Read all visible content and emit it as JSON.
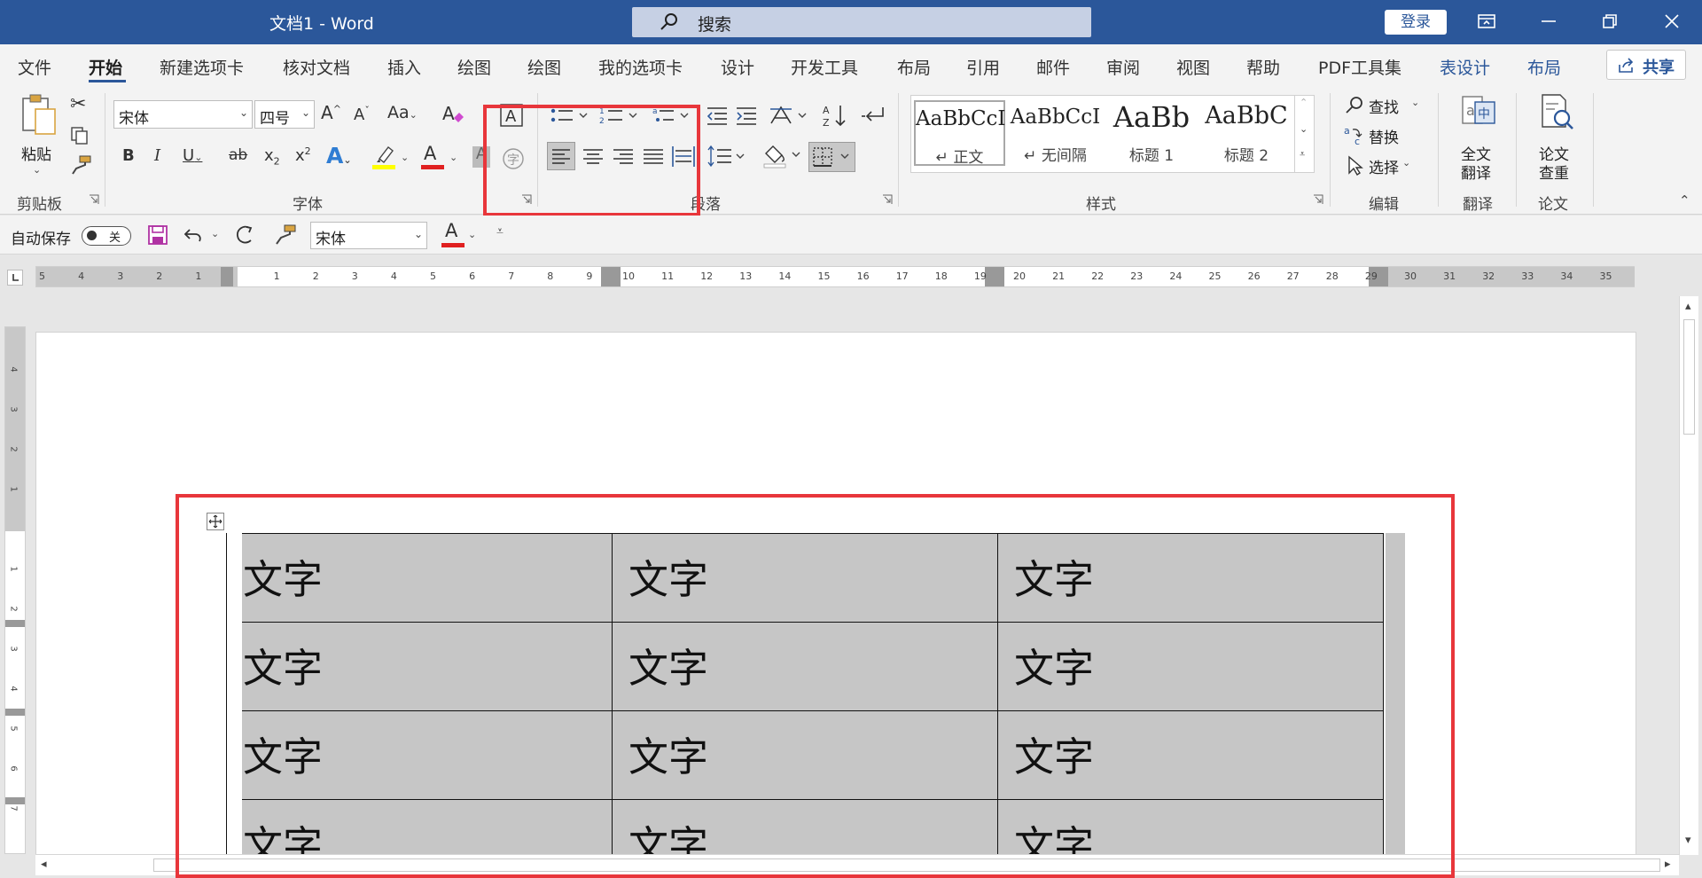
{
  "title_bar": {
    "doc_title": "文档1  -  Word",
    "search_placeholder": "搜索",
    "login_label": "登录"
  },
  "ribbon_tabs": [
    {
      "label": "文件"
    },
    {
      "label": "开始",
      "active": true
    },
    {
      "label": "新建选项卡"
    },
    {
      "label": "核对文档"
    },
    {
      "label": "插入"
    },
    {
      "label": "绘图"
    },
    {
      "label": "绘图"
    },
    {
      "label": "我的选项卡"
    },
    {
      "label": "设计"
    },
    {
      "label": "开发工具"
    },
    {
      "label": "布局"
    },
    {
      "label": "引用"
    },
    {
      "label": "邮件"
    },
    {
      "label": "审阅"
    },
    {
      "label": "视图"
    },
    {
      "label": "帮助"
    },
    {
      "label": "PDF工具集"
    },
    {
      "label": "表设计",
      "contextual": true
    },
    {
      "label": "布局",
      "contextual": true
    }
  ],
  "share_label": "共享",
  "clipboard": {
    "paste_label": "粘贴",
    "group_label": "剪贴板"
  },
  "font": {
    "name": "宋体",
    "size": "四号",
    "group_label": "字体"
  },
  "paragraph": {
    "group_label": "段落"
  },
  "styles": {
    "group_label": "样式",
    "cards": [
      {
        "sample": "AaBbCcI",
        "name": "↵ 正文"
      },
      {
        "sample": "AaBbCcI",
        "name": "↵ 无间隔"
      },
      {
        "sample": "AaBb",
        "name": "标题 1"
      },
      {
        "sample": "AaBbC",
        "name": "标题 2"
      }
    ]
  },
  "editing": {
    "find_label": "查找",
    "replace_label": "替换",
    "select_label": "选择",
    "group_label": "编辑"
  },
  "translate": {
    "button_label_1": "全文",
    "button_label_2": "翻译",
    "group_label": "翻译"
  },
  "thesis": {
    "button_label_1": "论文",
    "button_label_2": "查重",
    "group_label": "论文"
  },
  "qat": {
    "autosave_label": "自动保存",
    "autosave_state": "关",
    "font_name": "宋体"
  },
  "ruler": {
    "ticks": [
      "5",
      "4",
      "3",
      "2",
      "1",
      "1",
      "2",
      "3",
      "4",
      "5",
      "6",
      "7",
      "8",
      "9",
      "10",
      "11",
      "12",
      "13",
      "14",
      "15",
      "16",
      "17",
      "18",
      "19",
      "20",
      "21",
      "22",
      "23",
      "24",
      "25",
      "26",
      "27",
      "28",
      "29",
      "30",
      "31",
      "32",
      "33",
      "34",
      "35"
    ],
    "vticks": [
      "4",
      "3",
      "2",
      "1",
      "1",
      "2",
      "3",
      "4",
      "5",
      "6",
      "7"
    ]
  },
  "table": {
    "rows": [
      [
        "文字",
        "文字",
        "文字"
      ],
      [
        "文字",
        "文字",
        "文字"
      ],
      [
        "文字",
        "文字",
        "文字"
      ],
      [
        "文字",
        "文字",
        "文字"
      ]
    ]
  },
  "colors": {
    "accent": "#2b579a",
    "highlight_box": "#e8363b",
    "table_fill": "#c6c6c6",
    "font_color_bar": "#e02020",
    "highlight_bar": "#ffff00"
  }
}
